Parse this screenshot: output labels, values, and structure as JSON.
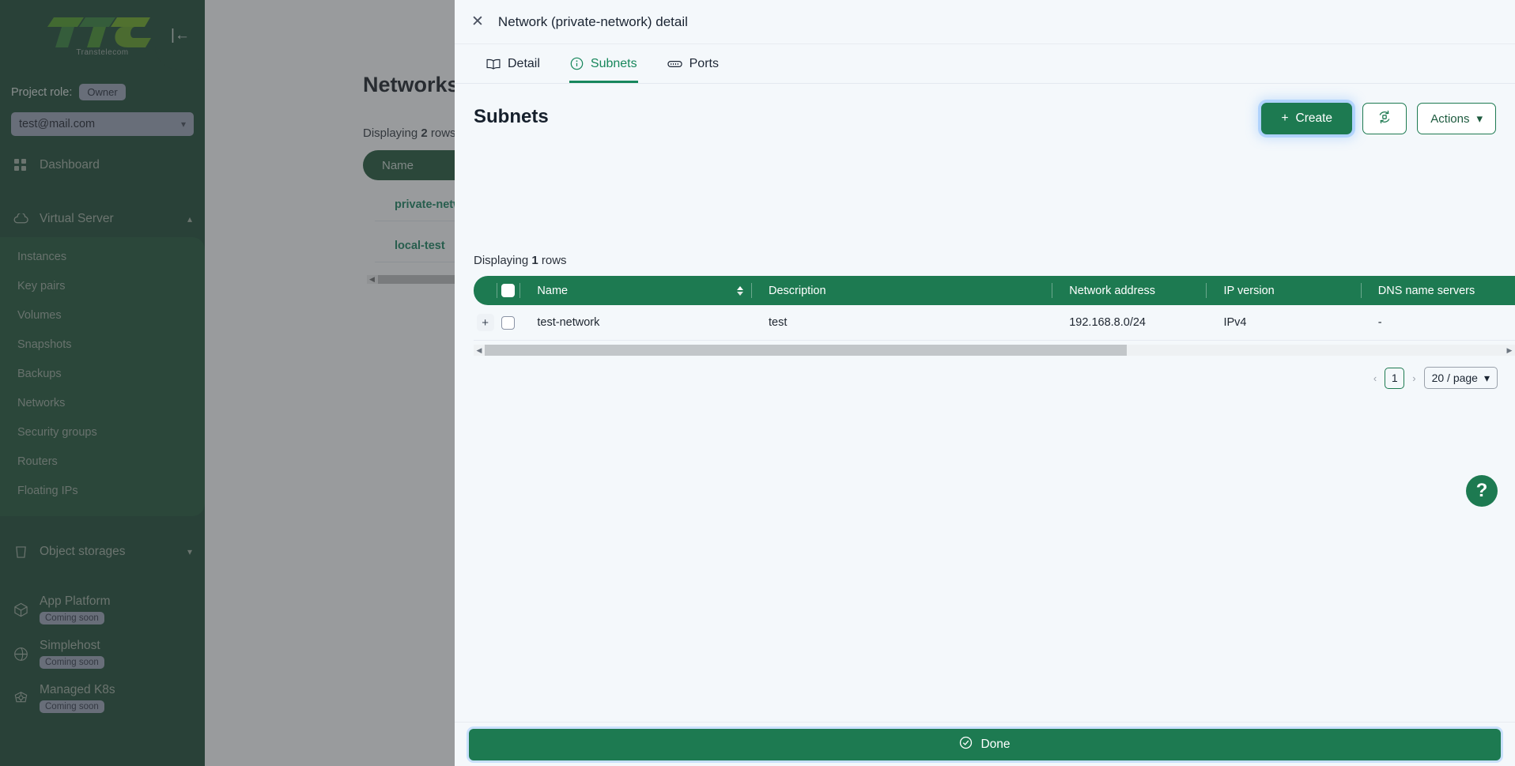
{
  "sidebar": {
    "logo_text": "TTC",
    "logo_subtitle": "Transtelecom",
    "collapse_icon": "collapse-left-icon",
    "project_role_label": "Project role:",
    "project_role_value": "Owner",
    "project_value": "test@mail.com",
    "dashboard": {
      "label": "Dashboard",
      "icon": "grid-icon"
    },
    "groups": [
      {
        "label": "Virtual Server",
        "icon": "cloud-icon",
        "expanded": true,
        "items": [
          {
            "label": "Instances"
          },
          {
            "label": "Key pairs"
          },
          {
            "label": "Volumes"
          },
          {
            "label": "Snapshots"
          },
          {
            "label": "Backups"
          },
          {
            "label": "Networks"
          },
          {
            "label": "Security groups"
          },
          {
            "label": "Routers"
          },
          {
            "label": "Floating IPs"
          }
        ]
      }
    ],
    "object_storages": {
      "label": "Object storages",
      "icon": "bucket-icon"
    },
    "coming_soon": [
      {
        "label": "App Platform",
        "badge": "Coming soon",
        "icon": "cube-icon"
      },
      {
        "label": "Simplehost",
        "badge": "Coming soon",
        "icon": "globe-icon"
      },
      {
        "label": "Managed K8s",
        "badge": "Coming soon",
        "icon": "kubernetes-icon"
      }
    ]
  },
  "background_page": {
    "title": "Networks",
    "rows_prefix": "Displaying",
    "rows_count": "2",
    "rows_suffix": "rows",
    "column_name": "Name",
    "rows": [
      {
        "name": "private-network"
      },
      {
        "name": "local-test"
      }
    ]
  },
  "modal": {
    "title": "Network (private-network) detail",
    "close_icon": "close-icon",
    "tabs": [
      {
        "label": "Detail",
        "icon": "book-icon",
        "active": false
      },
      {
        "label": "Subnets",
        "icon": "info-circle-icon",
        "active": true
      },
      {
        "label": "Ports",
        "icon": "ethernet-icon",
        "active": false
      }
    ],
    "section_title": "Subnets",
    "toolbar": {
      "create_label": "Create",
      "create_icon": "plus-icon",
      "refresh_icon": "refresh-icon",
      "actions_label": "Actions",
      "actions_chevron": "chevron-down-icon"
    },
    "rows_prefix": "Displaying",
    "rows_count": "1",
    "rows_suffix": "rows",
    "table": {
      "columns": [
        "Name",
        "Description",
        "Network address",
        "IP version",
        "DNS name servers"
      ],
      "rows": [
        {
          "name": "test-network",
          "description": "test",
          "network_address": "192.168.8.0/24",
          "ip_version": "IPv4",
          "dns_name_servers": "-"
        }
      ]
    },
    "pagination": {
      "prev_icon": "chevron-left-icon",
      "page": "1",
      "next_icon": "chevron-right-icon",
      "page_size": "20 / page",
      "page_size_chevron": "chevron-down-icon"
    },
    "help_label": "?",
    "done_label": "Done",
    "done_icon": "check-circle-icon"
  },
  "colors": {
    "brand_green": "#1d7a51",
    "sidebar_dark": "#16432c",
    "sidebar_sub": "#1a5130",
    "modal_bg": "#f4f8fb"
  }
}
